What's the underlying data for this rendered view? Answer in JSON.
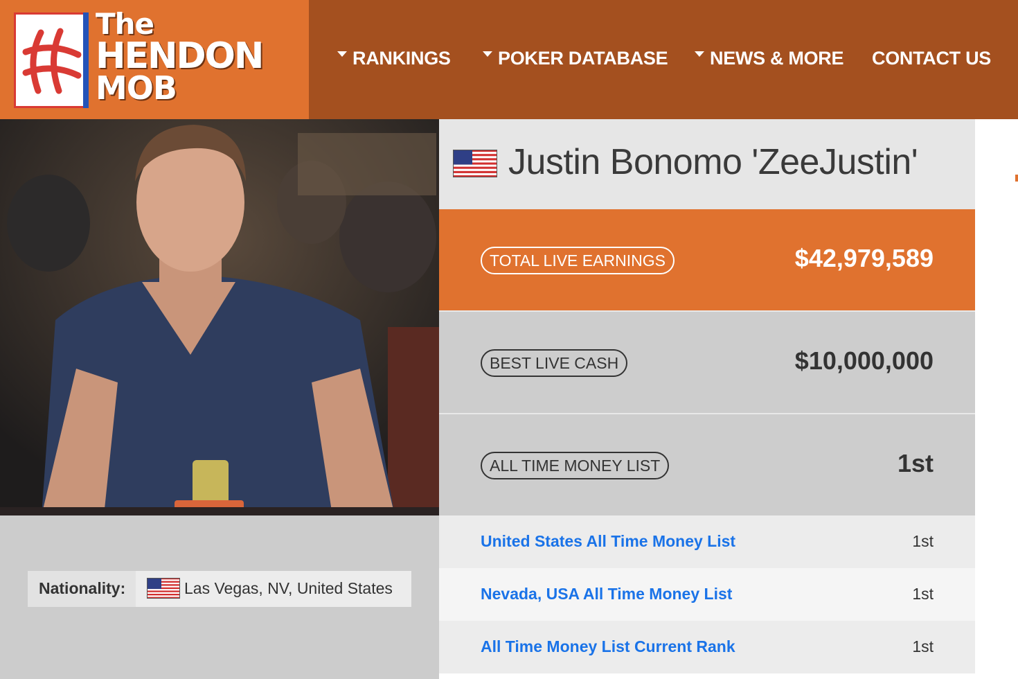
{
  "logo": {
    "line1": "The",
    "line2": "HENDON",
    "line3": "MOB"
  },
  "nav": [
    {
      "label": "RANKINGS",
      "has_dropdown": true
    },
    {
      "label": "POKER DATABASE",
      "has_dropdown": true
    },
    {
      "label": "NEWS & MORE",
      "has_dropdown": true
    },
    {
      "label": "CONTACT US",
      "has_dropdown": false
    }
  ],
  "player": {
    "name": "Justin Bonomo 'ZeeJustin'",
    "flag_icon": "us-flag-icon",
    "nationality_label": "Nationality:",
    "nationality_value": "Las Vegas, NV, United States"
  },
  "stats": [
    {
      "label": "TOTAL LIVE EARNINGS",
      "value": "$42,979,589"
    },
    {
      "label": "BEST LIVE CASH",
      "value": "$10,000,000"
    },
    {
      "label": "ALL TIME MONEY LIST",
      "value": "1st"
    }
  ],
  "rankings": [
    {
      "label": "United States All Time Money List",
      "value": "1st"
    },
    {
      "label": "Nevada, USA All Time Money List",
      "value": "1st"
    },
    {
      "label": "All Time Money List Current Rank",
      "value": "1st"
    }
  ],
  "colors": {
    "header_brown": "#a4501f",
    "brand_orange": "#e0722f",
    "link_blue": "#1a73e8",
    "panel_grey": "#cdcdcd"
  }
}
